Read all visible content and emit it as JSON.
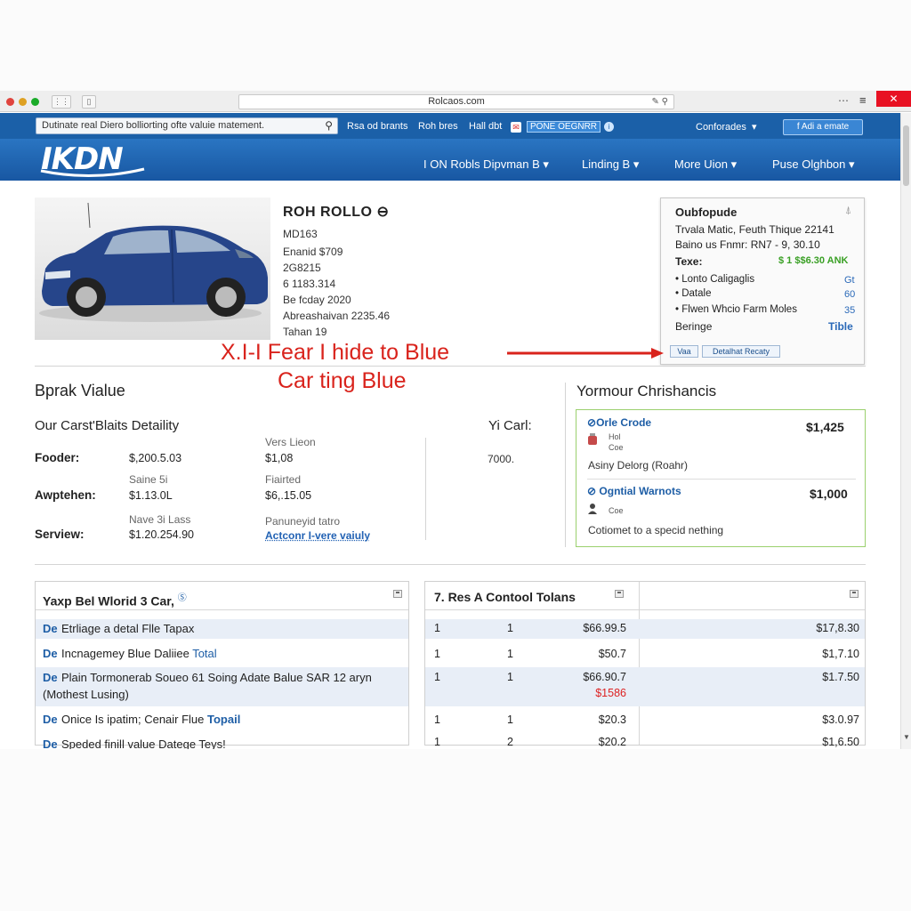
{
  "browser": {
    "url": "Rolcaos.com",
    "url_icons": "✎ ⚲"
  },
  "topbar": {
    "search_value": "Dutinate real Diero bolliorting ofte valuie matement.",
    "links": [
      "Rsa od brants",
      "Roh bres",
      "Hall dbt"
    ],
    "promo_text": "PONE OEGNRR",
    "account": "Conforades",
    "add_button": "f Adi a emate"
  },
  "navbar": {
    "logo": "IKDN",
    "items": [
      "I ON Robls Dipvman B",
      "Linding B",
      "More Uion",
      "Puse Olghbon"
    ]
  },
  "car": {
    "title": "ROH ROLLO",
    "specs": [
      "MD163",
      "Enanid $709",
      "2G8215",
      "6 1183.314",
      "Be fcday 2020",
      "Abreashaivan 2235.46",
      "Tahan 19"
    ]
  },
  "popup": {
    "title": "Oubfopude",
    "line1": "Trvala Matic, Feuth Thique 22141",
    "line2": "Baino us Fnmr: RN7 - 9, 30.10",
    "texe_label": "Texe:",
    "texe_value": "$ 1 $$6.30 ANK",
    "items": [
      {
        "label": "Lonto Caligaglis",
        "value": "Gt"
      },
      {
        "label": "Datale",
        "value": "60"
      },
      {
        "label": "Flwen Whcio Farm Moles",
        "value": "35"
      }
    ],
    "beringe_label": "Beringe",
    "beringe_value": "Tible",
    "btn1": "Vaa",
    "btn2": "Detalhat Recaty"
  },
  "callout": {
    "line1": "X.I-I Fear I hide to Blue",
    "line2": "Car ting Blue",
    "color": "#d9231c"
  },
  "breakdown": {
    "title": "Bprak Vialue",
    "details_title": "Our Carst'Blaits Detaility",
    "right_label": "Yi Carl:",
    "right_value": "7000.",
    "rows": [
      {
        "label": "Fooder:",
        "value": "$,200.5.03",
        "col2_label": "Vers Lieon",
        "col2_value": "$1,08"
      },
      {
        "label": "Awptehen:",
        "sub": "Saine 5i",
        "value": "$1.13.0L",
        "col2_label": "Fiairted",
        "col2_value": "$6,.15.05"
      },
      {
        "label": "Serview:",
        "sub": "Nave 3i Lass",
        "value": "$1.20.254.90",
        "col2_label": "Panuneyid tatro",
        "col2_value": "Actconr I-vere vaiuly"
      }
    ]
  },
  "charges": {
    "title": "Yormour Chrishancis",
    "items": [
      {
        "name": "Orle Crode",
        "price": "$1,425",
        "small1": "Hol",
        "small2": "Coe",
        "desc": "Asiny Delorg (Roahr)"
      },
      {
        "name": "Ogntial Warnots",
        "price": "$1,000",
        "small1": "Coe",
        "desc": "Cotiomet to a specid nething"
      }
    ]
  },
  "left_panel": {
    "title": "Yaxp Bel Wlorid 3 Car,",
    "title_mark": "Ⓢ",
    "prefix": "De",
    "rows": [
      {
        "text": "Etrliage a detal Flle Tapax",
        "link": ""
      },
      {
        "text": "Incnagemey Blue Daliiee ",
        "link": "Total"
      },
      {
        "text": "Plain Tormonerab Soueo 61 Soing Adate Balue SAR 12 aryn",
        "line2": "(Mothest Lusing)",
        "link": ""
      },
      {
        "text": "Onice Is ipatim; Cenair Flue ",
        "link": "Topail"
      },
      {
        "text": "Speded finill value Datege Teys!",
        "link": ""
      }
    ]
  },
  "right_panel": {
    "title": "7. Res A Contool Tolans",
    "rows": [
      {
        "c1": "1",
        "c2": "1",
        "c3": "$66.99.5",
        "c4": "$17,8.30"
      },
      {
        "c1": "1",
        "c2": "1",
        "c3": "$50.7",
        "c4": "$1,7.10"
      },
      {
        "c1": "1",
        "c2": "1",
        "c3": "$66.90.7",
        "c3b": "$1586",
        "c4": "$1.7.50"
      },
      {
        "c1": "1",
        "c2": "1",
        "c3": "$20.3",
        "c4": "$3.0.97"
      },
      {
        "c1": "1",
        "c2": "2",
        "c3": "$20.2",
        "c4": "$1,6.50"
      }
    ]
  }
}
